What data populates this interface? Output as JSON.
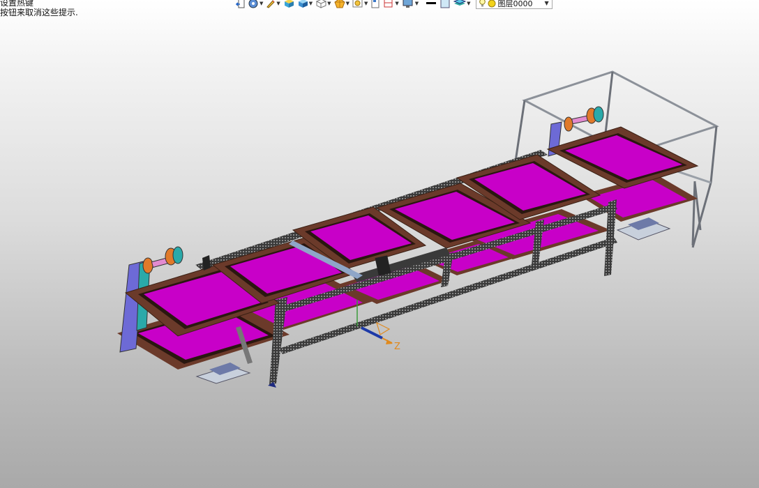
{
  "hints": {
    "line1": "设置热键",
    "line2": "按钮来取消这些提示."
  },
  "toolbar": {
    "items": [
      {
        "icon": "undo-arrow-icon",
        "caret": false
      },
      {
        "icon": "view-orient-icon",
        "caret": true
      },
      {
        "icon": "pencil-icon",
        "caret": true
      },
      {
        "icon": "shaded-box-icon",
        "caret": false
      },
      {
        "icon": "solid-cube-icon",
        "caret": true
      },
      {
        "icon": "wireframe-cube-icon",
        "caret": true
      },
      {
        "icon": "star-render-icon",
        "caret": true
      },
      {
        "icon": "display-style-icon",
        "caret": true
      },
      {
        "icon": "page-icon",
        "caret": false
      },
      {
        "icon": "section-view-icon",
        "caret": true
      },
      {
        "icon": "monitor-icon",
        "caret": true
      },
      {
        "icon": "line-color-icon",
        "caret": false
      },
      {
        "icon": "fill-color-icon",
        "caret": false
      },
      {
        "icon": "layers-icon",
        "caret": true
      }
    ],
    "layer_label": "图层0000",
    "colors": {
      "accent_blue": "#3b78c8",
      "bulb_yellow": "#f2d21a"
    }
  },
  "viewport": {
    "axis_label": "Z",
    "colors": {
      "screen_fill": "#cc00cc",
      "frame_brown": "#6b3a2a",
      "rail_dark": "#2b2b2b",
      "roller_blue": "#6d6ad6",
      "roller_teal": "#2aa9a9",
      "roller_orange": "#e07a2a",
      "frame_grey": "#9aa0a8",
      "axis_orange": "#e08a1e"
    }
  }
}
